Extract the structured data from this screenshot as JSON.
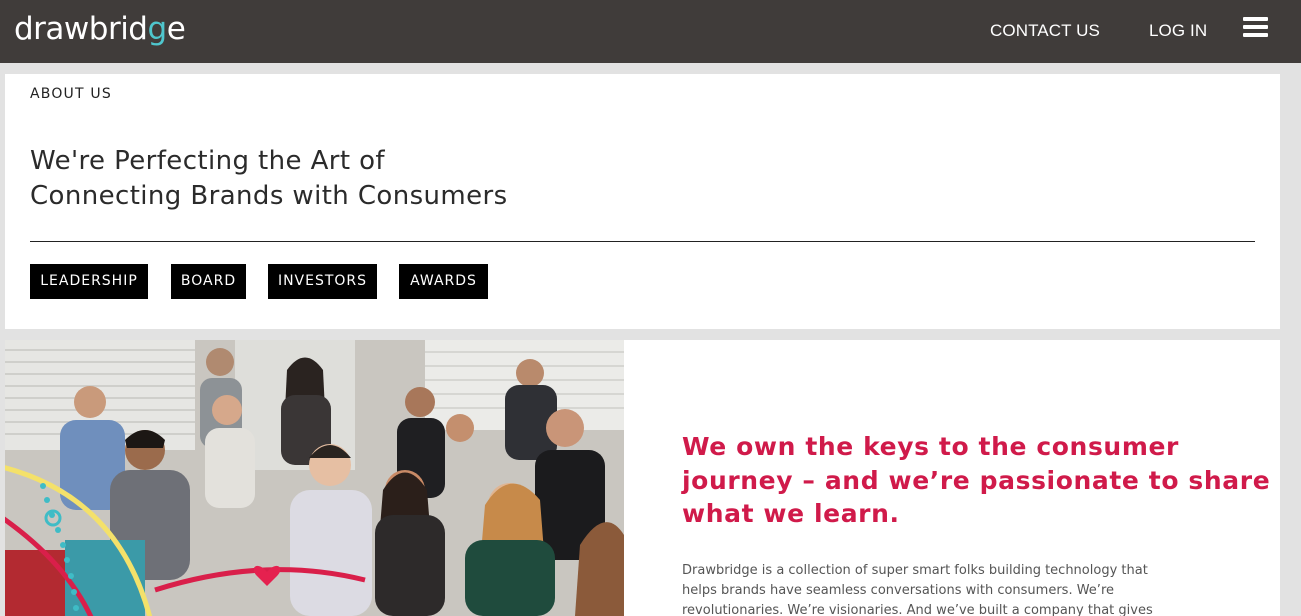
{
  "header": {
    "logo_text_main": "drawbrid",
    "logo_text_accent": "g",
    "logo_text_end": "e",
    "nav": {
      "contact": "CONTACT US",
      "login": "LOG IN"
    },
    "menu_icon": "hamburger-menu-icon"
  },
  "about": {
    "label": "ABOUT US",
    "title_line1": "We're Perfecting the Art of",
    "title_line2": "Connecting Brands with Consumers",
    "tabs": [
      "LEADERSHIP",
      "BOARD",
      "INVESTORS",
      "AWARDS"
    ]
  },
  "feature": {
    "photo": "team-photo",
    "tagline_line1": "We own the keys to the consumer",
    "tagline_line2": "journey – and we’re passionate to share",
    "tagline_line3": "what we learn.",
    "body_line1": "Drawbridge is a collection of super smart folks building technology that",
    "body_line2": "helps brands have seamless conversations with consumers. We’re",
    "body_line3": "revolutionaries. We’re visionaries. And we’ve built a company that gives"
  },
  "colors": {
    "header_bg": "#403c3a",
    "logo_accent": "#4fc6cd",
    "tagline": "#d01a4a",
    "page_bg": "#e2e2e2"
  }
}
